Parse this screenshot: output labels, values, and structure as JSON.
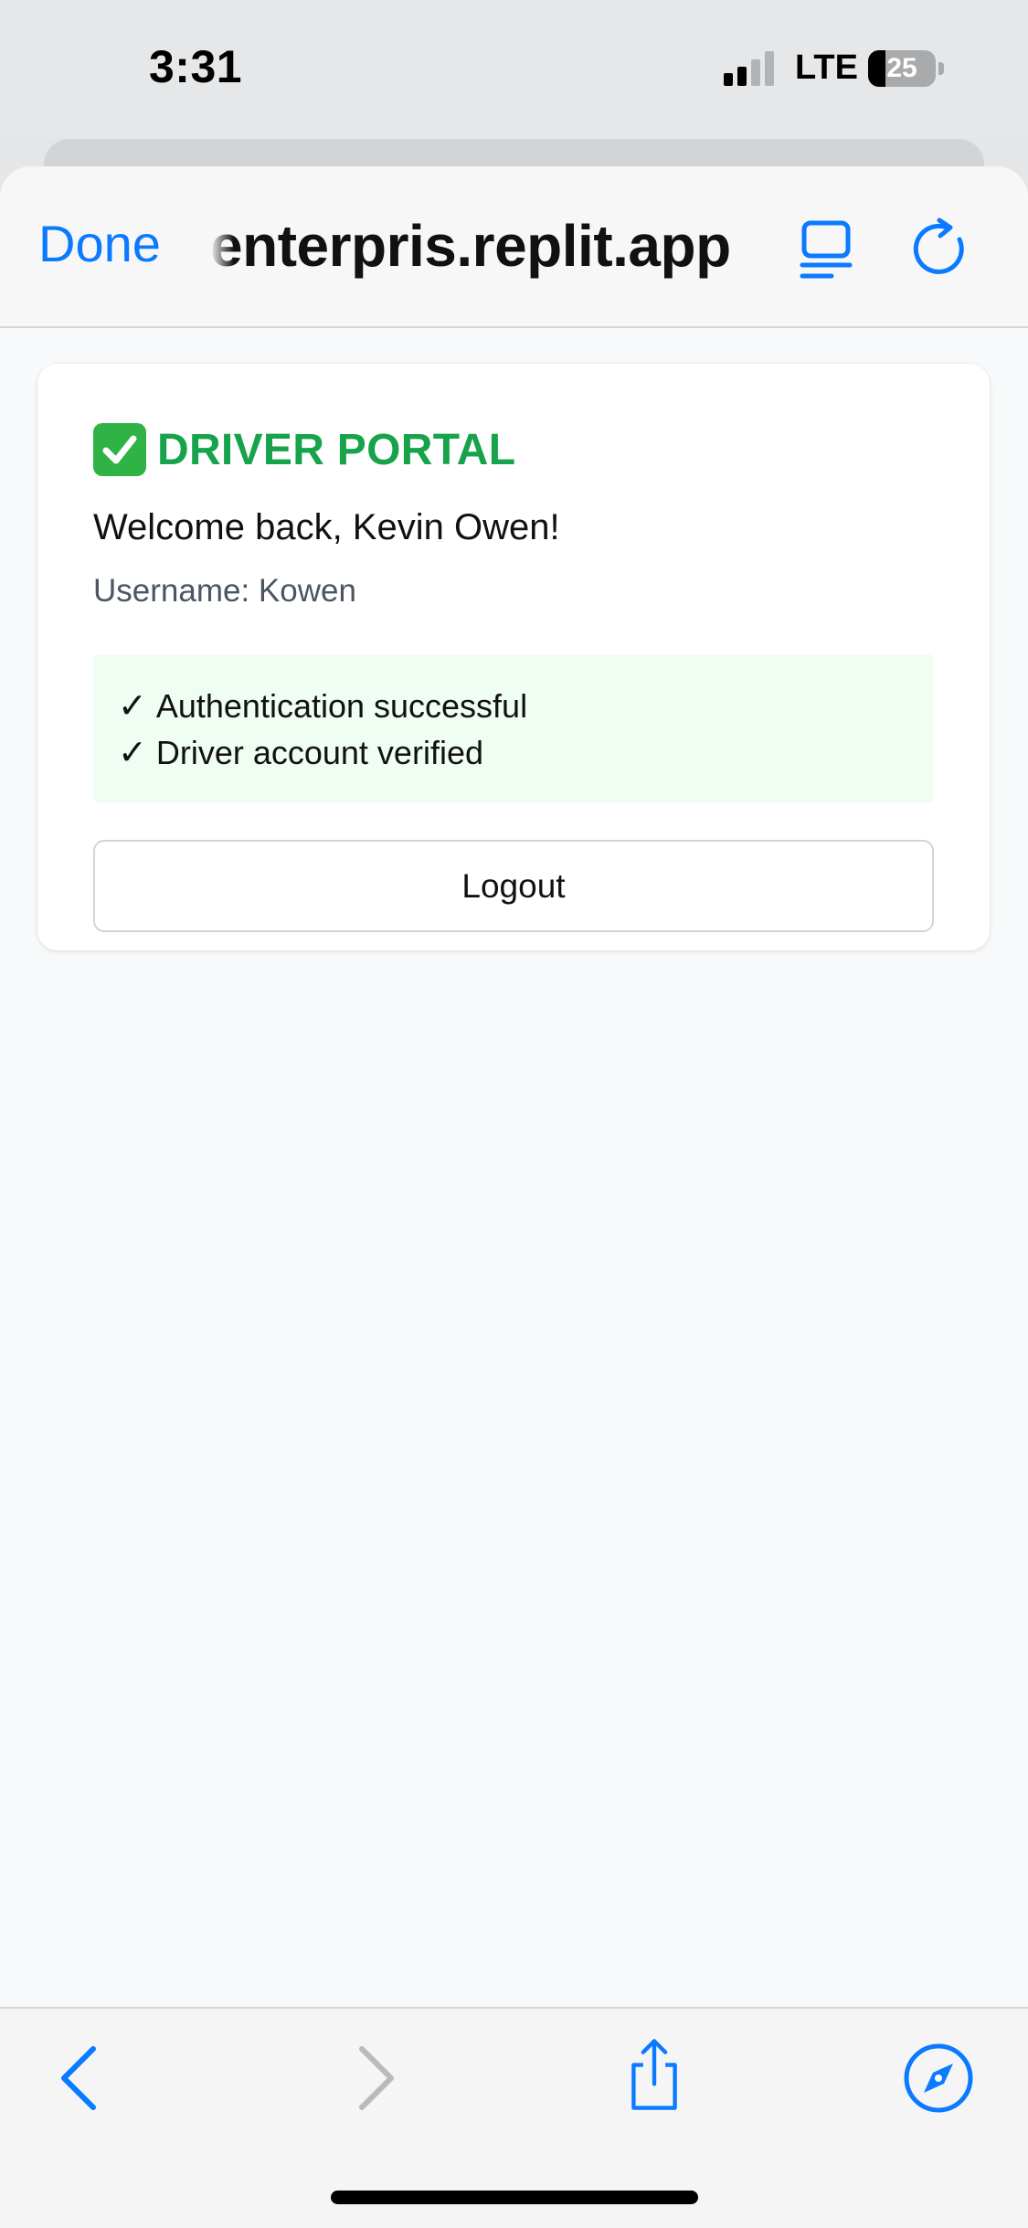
{
  "status_bar": {
    "time": "3:31",
    "network": "LTE",
    "battery_level": "25",
    "battery_fraction": 0.25,
    "signal_bars_active": 2,
    "signal_bars_total": 4
  },
  "browser": {
    "done_label": "Done",
    "url": "enterpris.replit.app",
    "tabs_icon": "tabs-icon",
    "reload_icon": "reload-icon"
  },
  "portal": {
    "title": "DRIVER PORTAL",
    "title_icon": "check-badge-icon",
    "welcome": "Welcome back, Kevin Owen!",
    "username_line": "Username: Kowen",
    "status_items": [
      "Authentication successful",
      "Driver account verified"
    ],
    "tick_glyph": "✓",
    "logout_label": "Logout"
  },
  "toolbar": {
    "back_icon": "chevron-left-icon",
    "forward_icon": "chevron-right-icon",
    "share_icon": "share-icon",
    "safari_icon": "compass-icon"
  },
  "colors": {
    "accent": "#0a7aff",
    "portal_green": "#16a34a",
    "success_bg": "#effdf3",
    "check_badge": "#2fb344"
  }
}
